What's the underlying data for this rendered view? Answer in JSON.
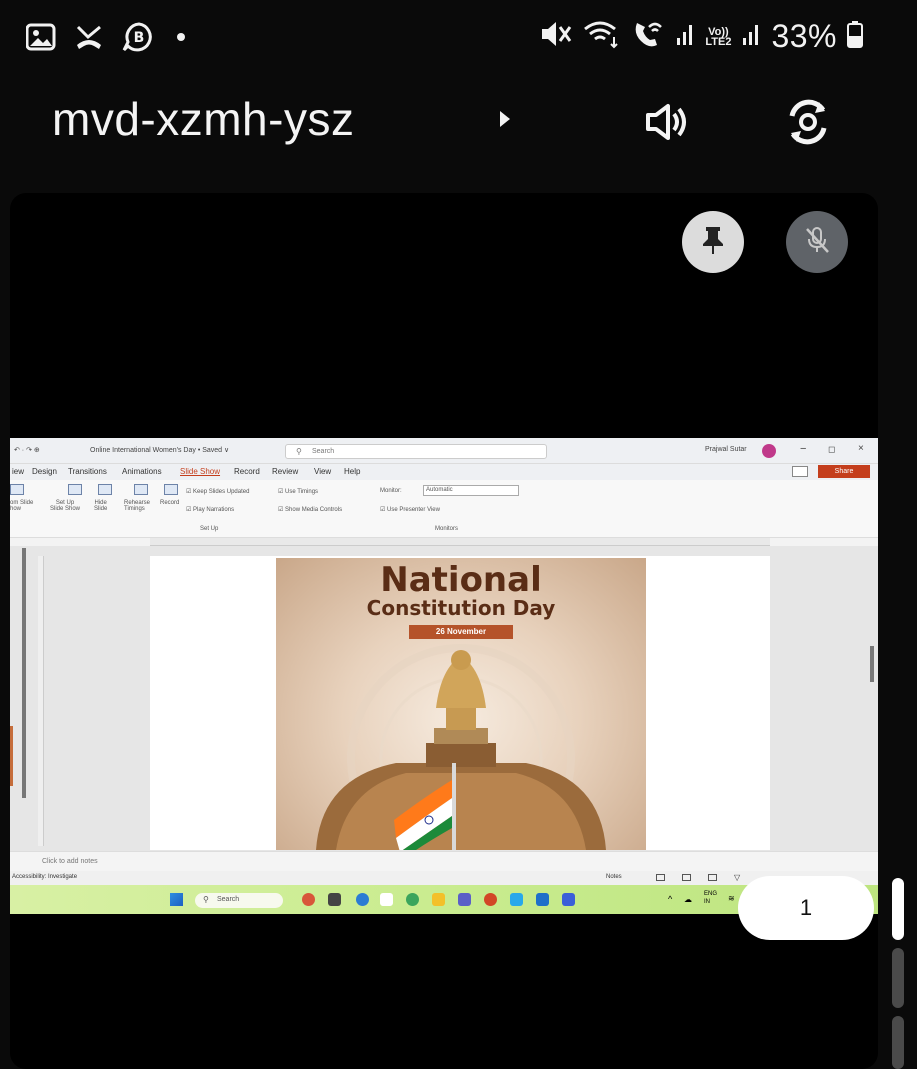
{
  "status_bar": {
    "battery_percent": "33%",
    "network_label_top": "Vo))",
    "network_label_bottom": "LTE2",
    "icons": [
      "image-icon",
      "missed-call-icon",
      "b-badge-icon",
      "notification-dot-icon",
      "mute-icon",
      "wifi-icon",
      "wifi-calling-icon",
      "signal-icon",
      "battery-icon"
    ]
  },
  "header": {
    "meeting_code": "mvd-xzmh-ysz",
    "icons": [
      "speaker-icon",
      "switch-camera-icon"
    ]
  },
  "tile": {
    "icons": [
      "pin-icon",
      "mic-off-icon"
    ],
    "page_number": "1"
  },
  "shared_screen": {
    "window_title": "Online International Women's Day • Saved ∨",
    "search_placeholder": "Search",
    "user_name": "Prajwal Sutar",
    "share_label": "Share",
    "menu": [
      "iew",
      "Design",
      "Transitions",
      "Animations",
      "Slide Show",
      "Record",
      "Review",
      "View",
      "Help"
    ],
    "active_menu": "Slide Show",
    "ribbon": {
      "btn_custom": "om Slide\nhow",
      "btn_setup": "Set Up\nSlide Show",
      "btn_hide": "Hide\nSlide",
      "btn_rehearse": "Rehearse\nTimings",
      "btn_record": "Record",
      "chk_keep": "Keep Slides Updated",
      "chk_play": "Play Narrations",
      "chk_timings": "Use Timings",
      "chk_media": "Show Media Controls",
      "group_setup": "Set Up",
      "monitor_label": "Monitor:",
      "monitor_value": "Automatic",
      "presenter": "Use Presenter View",
      "group_monitors": "Monitors"
    },
    "slide": {
      "title": "National",
      "subtitle": "Constitution Day",
      "date": "26 November"
    },
    "notes_placeholder": "Click to add notes",
    "status_text": "Accessibility: Investigate",
    "notes_btn": "Notes",
    "taskbar_search": "Search",
    "lang": "ENG\nIN"
  }
}
